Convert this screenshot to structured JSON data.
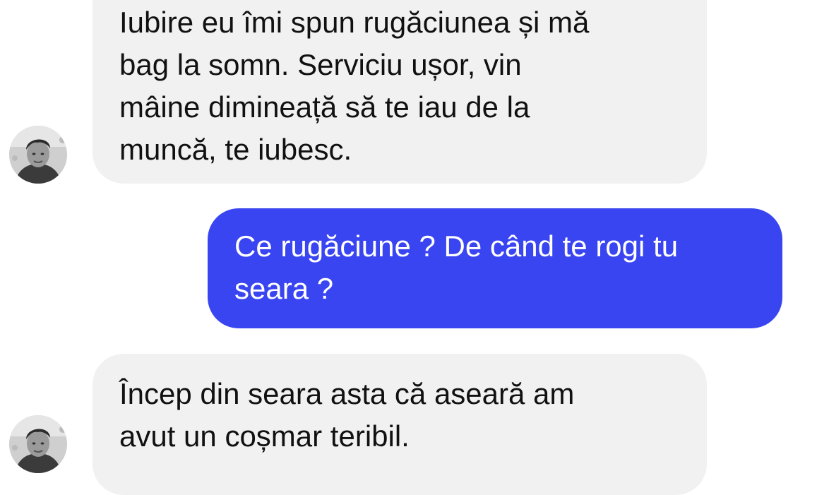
{
  "conversation": {
    "messages": [
      {
        "sender": "contact",
        "lines": [
          "Iubire eu îmi spun rugăciunea și mă",
          "bag la somn. Serviciu ușor, vin",
          "mâine dimineață să te iau de la",
          "muncă, te iubesc."
        ]
      },
      {
        "sender": "me",
        "lines": [
          "Ce rugăciune ? De când te rogi tu",
          "seara ?"
        ]
      },
      {
        "sender": "contact",
        "lines": [
          "Încep din seara asta că aseară am",
          "avut un coșmar  teribil."
        ]
      }
    ]
  },
  "colors": {
    "incoming_bubble": "#f1f1f2",
    "outgoing_bubble": "#3a45f2",
    "incoming_text": "#111111",
    "outgoing_text": "#ffffff"
  }
}
